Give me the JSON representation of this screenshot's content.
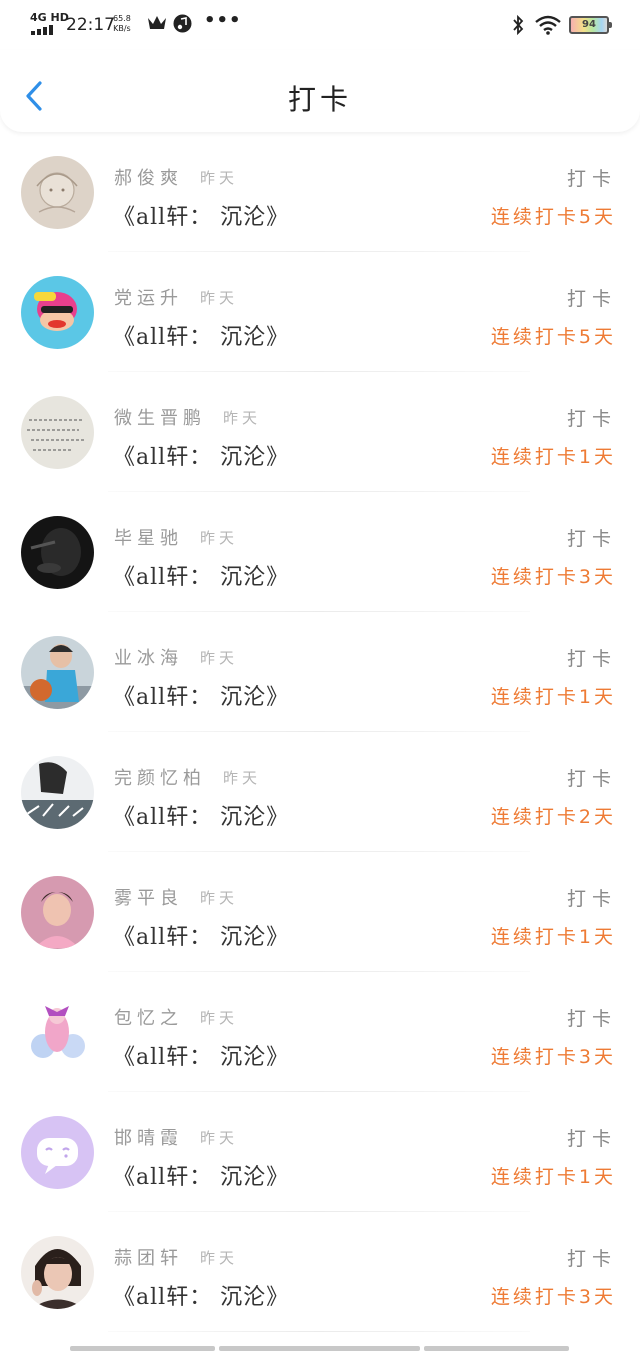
{
  "status_bar": {
    "network": "4G HD",
    "time": "22:17",
    "speed_value": "65.8",
    "speed_unit": "KB/s",
    "battery": "94"
  },
  "header": {
    "title": "打卡",
    "back_icon": "chevron-left-icon"
  },
  "colors": {
    "accent": "#2f8fe8",
    "streak": "#ee7b35",
    "name": "#9a9a9a",
    "time": "#b5b5b5"
  },
  "checkins": [
    {
      "name": "郝俊爽",
      "time": "昨天",
      "book": "《all轩： 沉沦》",
      "action": "打卡",
      "streak": "连续打卡5天"
    },
    {
      "name": "党运升",
      "time": "昨天",
      "book": "《all轩： 沉沦》",
      "action": "打卡",
      "streak": "连续打卡5天"
    },
    {
      "name": "微生晋鹏",
      "time": "昨天",
      "book": "《all轩： 沉沦》",
      "action": "打卡",
      "streak": "连续打卡1天"
    },
    {
      "name": "毕星驰",
      "time": "昨天",
      "book": "《all轩： 沉沦》",
      "action": "打卡",
      "streak": "连续打卡3天"
    },
    {
      "name": "业冰海",
      "time": "昨天",
      "book": "《all轩： 沉沦》",
      "action": "打卡",
      "streak": "连续打卡1天"
    },
    {
      "name": "完颜忆柏",
      "time": "昨天",
      "book": "《all轩： 沉沦》",
      "action": "打卡",
      "streak": "连续打卡2天"
    },
    {
      "name": "雾平良",
      "time": "昨天",
      "book": "《all轩： 沉沦》",
      "action": "打卡",
      "streak": "连续打卡1天"
    },
    {
      "name": "包忆之",
      "time": "昨天",
      "book": "《all轩： 沉沦》",
      "action": "打卡",
      "streak": "连续打卡3天"
    },
    {
      "name": "邯晴霞",
      "time": "昨天",
      "book": "《all轩： 沉沦》",
      "action": "打卡",
      "streak": "连续打卡1天"
    },
    {
      "name": "蒜团轩",
      "time": "昨天",
      "book": "《all轩： 沉沦》",
      "action": "打卡",
      "streak": "连续打卡3天"
    }
  ]
}
